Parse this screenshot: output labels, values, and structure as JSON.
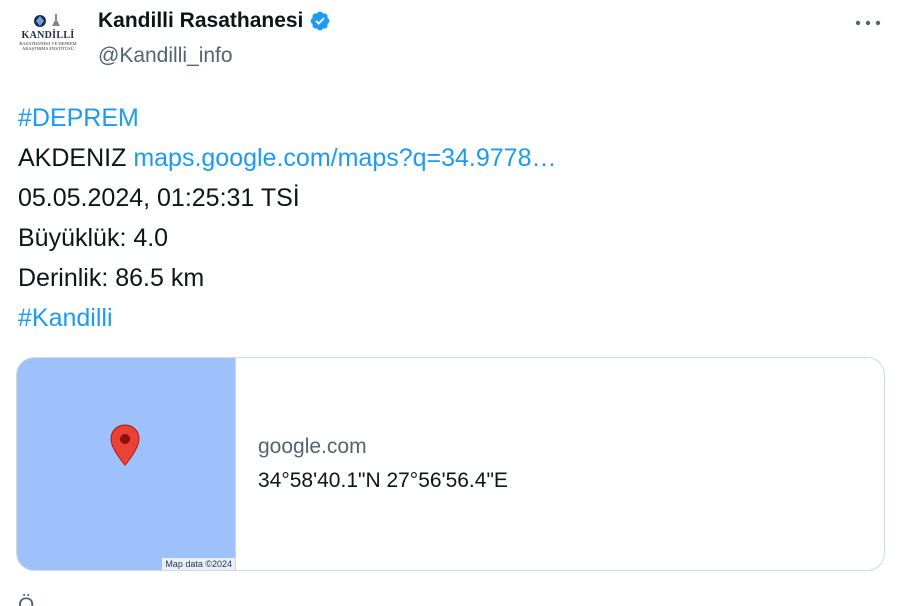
{
  "colors": {
    "accent": "#1d9bf0",
    "verified_badge": "#1d9bf0",
    "map_water": "#9fc1fb",
    "pin": "#ea4335"
  },
  "account": {
    "display_name": "Kandilli Rasathanesi",
    "handle": "@Kandilli_info",
    "verified": true,
    "avatar_logo_text": "KANDİLLİ",
    "avatar_logo_sub": "RASATHANESİ VE DEPREM ARAŞTIRMA ENSTİTÜSÜ"
  },
  "icons": {
    "more": "more-horizontal-icon",
    "verified": "verified-badge-icon",
    "pin": "map-pin-icon"
  },
  "tweet": {
    "hashtag_1": "#DEPREM",
    "location_label": "AKDENIZ",
    "location_link": "maps.google.com/maps?q=34.9778…",
    "datetime": "05.05.2024, 01:25:31 TSİ",
    "magnitude": "Büyüklük: 4.0",
    "depth": "Derinlik: 86.5 km",
    "hashtag_2": "#Kandilli"
  },
  "link_card": {
    "domain": "google.com",
    "title": "34°58'40.1\"N 27°56'56.4\"E",
    "map_attribution": "Map data ©2024"
  },
  "footer": {
    "partial_text": "Ö"
  }
}
